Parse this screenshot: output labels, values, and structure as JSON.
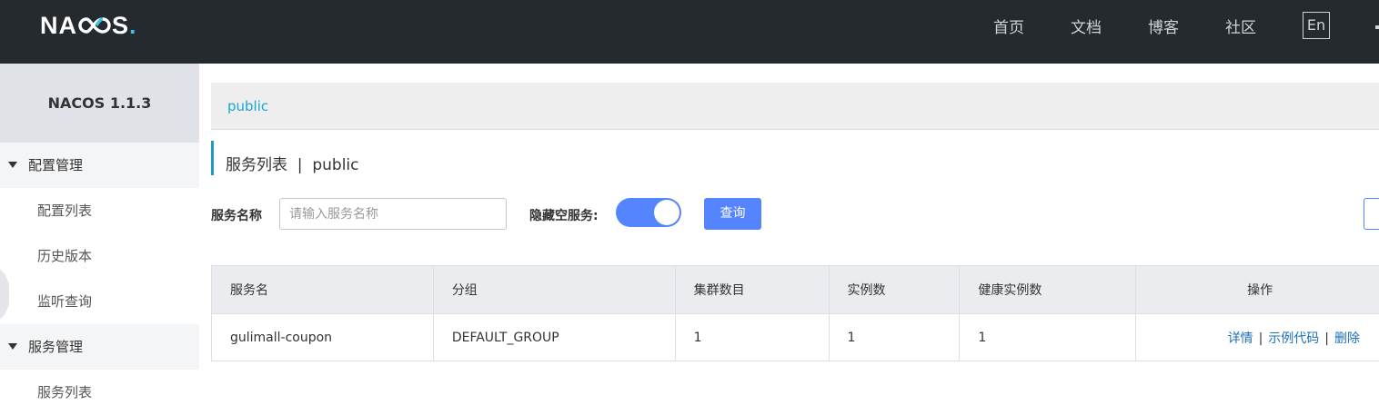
{
  "header": {
    "logo_text": {
      "left": "NA",
      "right": "S",
      "dot": "."
    },
    "nav": [
      {
        "label": "首页"
      },
      {
        "label": "文档"
      },
      {
        "label": "博客"
      },
      {
        "label": "社区"
      }
    ],
    "lang_label": "En"
  },
  "sidebar": {
    "version": "NACOS 1.1.3",
    "groups": [
      {
        "label": "配置管理",
        "items": [
          "配置列表",
          "历史版本",
          "监听查询"
        ]
      },
      {
        "label": "服务管理",
        "items": [
          "服务列表"
        ]
      }
    ]
  },
  "main": {
    "namespace_tab": "public",
    "title": "服务列表  |  public",
    "filters": {
      "service_name_label": "服务名称",
      "service_name_placeholder": "请输入服务名称",
      "hide_empty_label": "隐藏空服务:",
      "hide_empty_on": true,
      "query_label": "查询"
    },
    "table": {
      "headers": [
        "服务名",
        "分组",
        "集群数目",
        "实例数",
        "健康实例数",
        "操作"
      ],
      "rows": [
        {
          "service": "gulimall-coupon",
          "group": "DEFAULT_GROUP",
          "clusters": "1",
          "instances": "1",
          "healthy": "1",
          "ops": [
            "详情",
            "示例代码",
            "删除"
          ]
        }
      ]
    }
  },
  "colors": {
    "header_bg": "#252a2f",
    "accent_blue": "#5584ff",
    "link_blue": "#1b6fb5",
    "crumb_cyan": "#19a6d1"
  }
}
